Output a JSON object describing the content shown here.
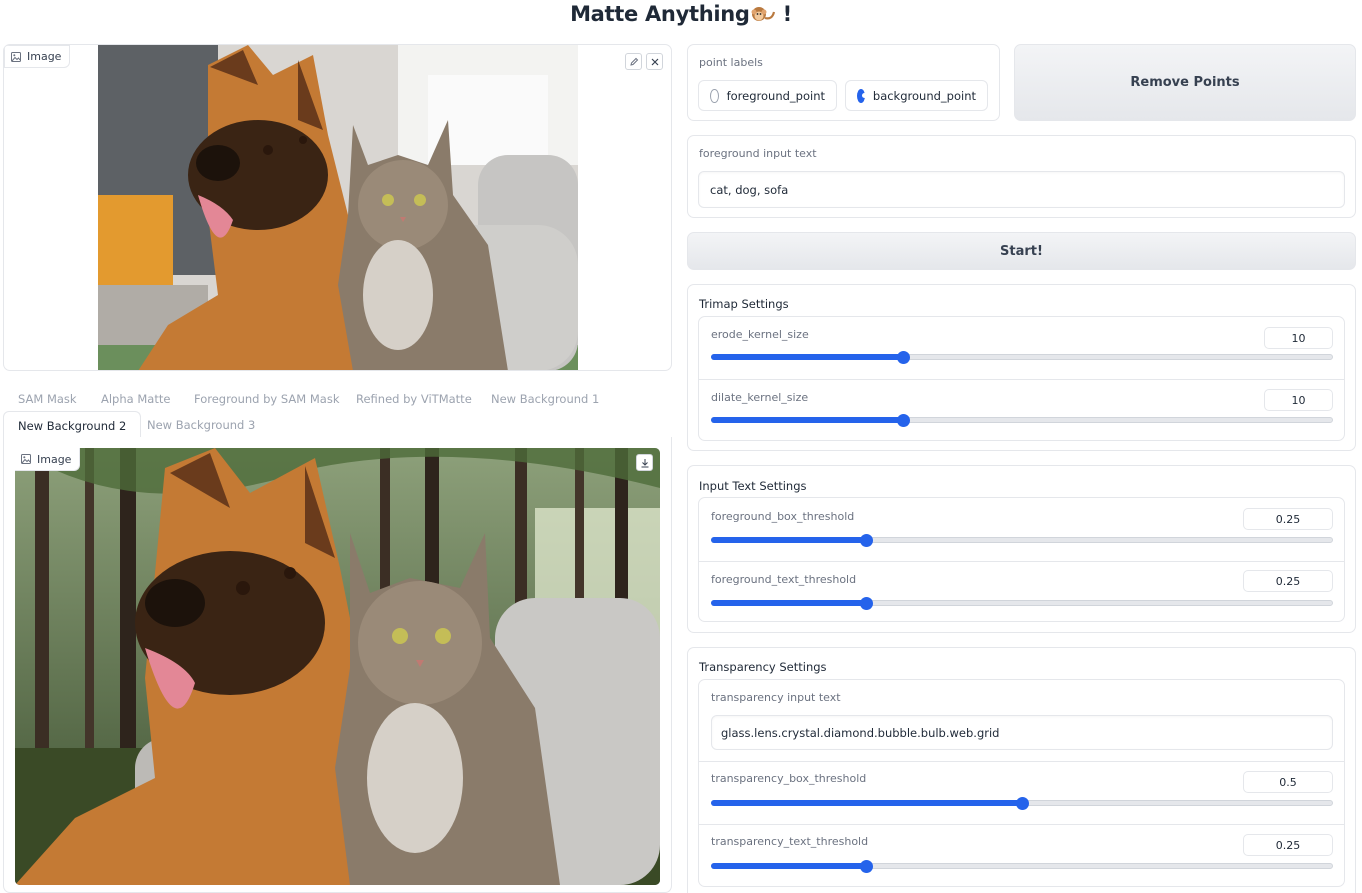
{
  "app": {
    "title": "Matte Anything",
    "title_suffix": "!"
  },
  "input_image": {
    "label": "Image",
    "edit_icon": "pencil-icon",
    "clear_icon": "close-icon"
  },
  "output_tabs": {
    "row1": [
      "SAM Mask",
      "Alpha Matte",
      "Foreground by SAM Mask",
      "Refined by ViTMatte",
      "New Background 1"
    ],
    "row2": [
      "New Background 2",
      "New Background 3"
    ],
    "selected": "New Background 2"
  },
  "output_image": {
    "label": "Image",
    "download_icon": "download-icon"
  },
  "point_labels": {
    "label": "point labels",
    "options": [
      "foreground_point",
      "background_point"
    ],
    "selected": "background_point"
  },
  "remove_points_label": "Remove Points",
  "foreground_text": {
    "label": "foreground input text",
    "value": "cat, dog, sofa"
  },
  "start_label": "Start!",
  "trimap": {
    "title": "Trimap Settings",
    "erode_label": "erode_kernel_size",
    "erode_value": "10",
    "erode_fraction": 0.31,
    "dilate_label": "dilate_kernel_size",
    "dilate_value": "10",
    "dilate_fraction": 0.31
  },
  "input_text_settings": {
    "title": "Input Text Settings",
    "box_label": "foreground_box_threshold",
    "box_value": "0.25",
    "box_fraction": 0.25,
    "text_label": "foreground_text_threshold",
    "text_value": "0.25",
    "text_fraction": 0.25
  },
  "transparency": {
    "title": "Transparency Settings",
    "input_label": "transparency input text",
    "input_value": "glass.lens.crystal.diamond.bubble.bulb.web.grid",
    "box_label": "transparency_box_threshold",
    "box_value": "0.5",
    "box_fraction": 0.5,
    "text_label": "transparency_text_threshold",
    "text_value": "0.25",
    "text_fraction": 0.25
  },
  "colors": {
    "accent": "#2563eb",
    "border": "#e5e7eb",
    "muted_text": "#9ca3af"
  }
}
